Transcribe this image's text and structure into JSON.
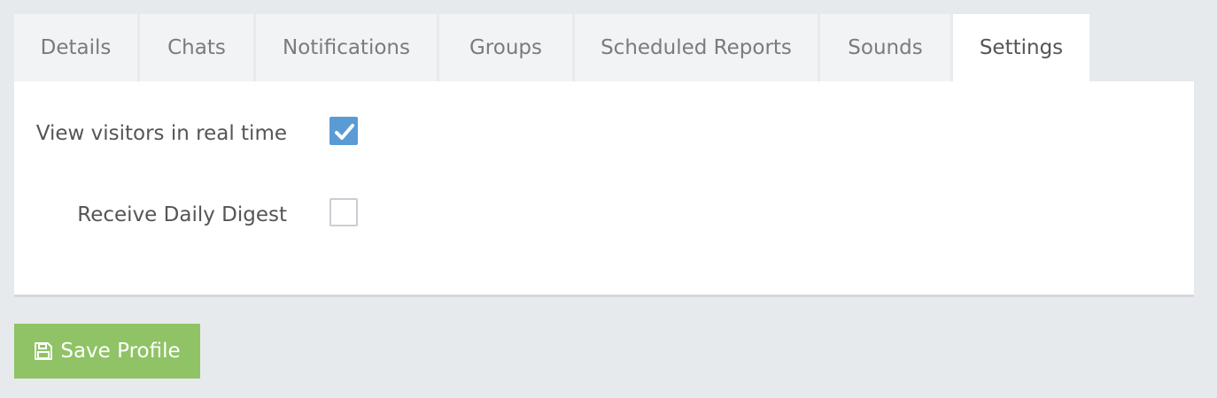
{
  "tabs": [
    {
      "label": "Details",
      "active": false
    },
    {
      "label": "Chats",
      "active": false
    },
    {
      "label": "Notifications",
      "active": false
    },
    {
      "label": "Groups",
      "active": false
    },
    {
      "label": "Scheduled Reports",
      "active": false
    },
    {
      "label": "Sounds",
      "active": false
    },
    {
      "label": "Settings",
      "active": true
    }
  ],
  "settings": {
    "realtime": {
      "label": "View visitors in real time",
      "checked": true
    },
    "digest": {
      "label": "Receive Daily Digest",
      "checked": false
    }
  },
  "actions": {
    "save_label": "Save Profile",
    "save_icon": "floppy-disk-icon"
  },
  "colors": {
    "background": "#e7eaed",
    "checkbox_checked": "#5b9bd5",
    "save_button": "#8fc365"
  }
}
